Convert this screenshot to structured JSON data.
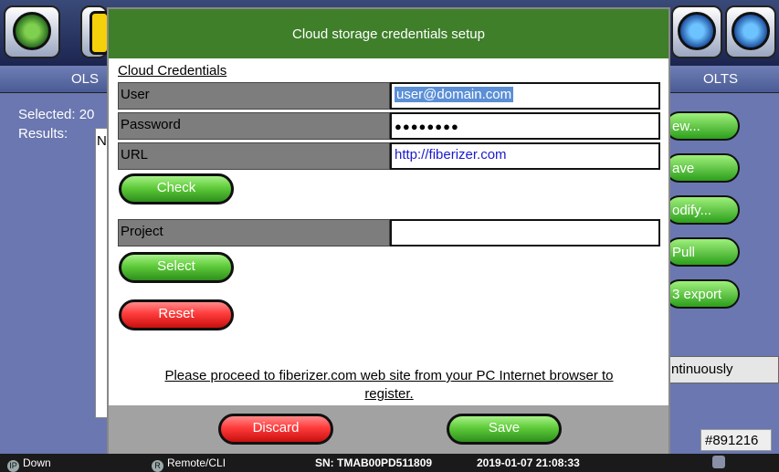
{
  "background": {
    "tab_left": "OLS",
    "tab_right": "OLTS",
    "selected_label": "Selected: 20",
    "results_label": "Results:",
    "list_letter": "N",
    "side_buttons": [
      "ew...",
      "ave",
      "odify...",
      "Pull",
      "3 export"
    ],
    "continuously_text": "ntinuously",
    "id_badge": "#891216"
  },
  "dialog": {
    "title": "Cloud storage credentials setup",
    "section_title": "Cloud Credentials",
    "user_label": "User",
    "user_value": "user@domain.com",
    "password_label": "Password",
    "password_value": "●●●●●●●●",
    "url_label": "URL",
    "url_value": "http://fiberizer.com",
    "check_button": "Check",
    "project_label": "Project",
    "project_value": "",
    "select_button": "Select",
    "reset_button": "Reset",
    "note_line1": "Please proceed to fiberizer.com web site from your PC Internet browser to",
    "note_line2": "register.",
    "discard_button": "Discard",
    "save_button": "Save"
  },
  "statusbar": {
    "ip_badge": "IP",
    "ip_status": "Down",
    "remote_badge": "R",
    "remote_status": "Remote/CLI",
    "serial": "SN: TMAB00PD511809",
    "datetime": "2019-01-07  21:08:33"
  },
  "colors": {
    "dialog_header": "#3f7f2a",
    "green_button": "#5fcb3a",
    "red_button": "#ff3b3b",
    "url_text": "#1b1bcc"
  },
  "icons": [
    "home-icon",
    "battery-icon",
    "globe-icon",
    "transfer-icon"
  ]
}
